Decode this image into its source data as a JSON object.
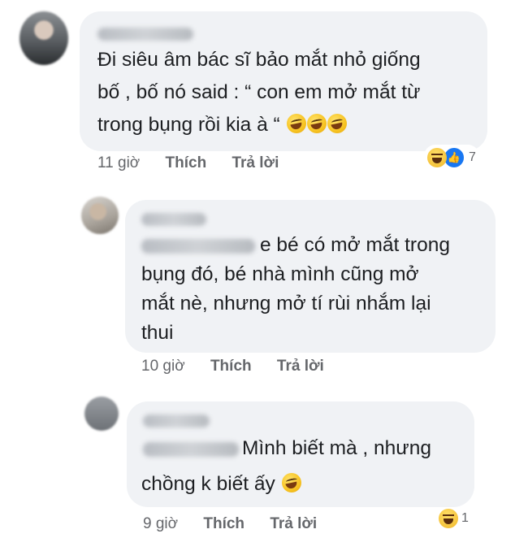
{
  "comments": [
    {
      "lines": [
        "Đi siêu âm bác sĩ bảo mắt nhỏ giống",
        "bố , bố nó said : “ con em mở mắt từ",
        "trong bụng rồi kia à “"
      ],
      "emoji_count": 3,
      "time": "11 giờ",
      "like_label": "Thích",
      "reply_label": "Trả lời",
      "reactions": [
        "haha-icon",
        "like-icon"
      ],
      "reaction_count": "7"
    },
    {
      "lines": [
        "e bé có mở mắt trong",
        "bụng đó, bé nhà mình cũng mở",
        "mắt nè, nhưng mở tí rùi nhắm lại",
        "thui"
      ],
      "time": "10 giờ",
      "like_label": "Thích",
      "reply_label": "Trả lời"
    },
    {
      "lines": [
        "Mình biết mà , nhưng",
        "chồng k biết ấy"
      ],
      "emoji_count": 1,
      "time": "9 giờ",
      "like_label": "Thích",
      "reply_label": "Trả lời",
      "reactions": [
        "haha-icon"
      ],
      "reaction_count": "1"
    }
  ]
}
